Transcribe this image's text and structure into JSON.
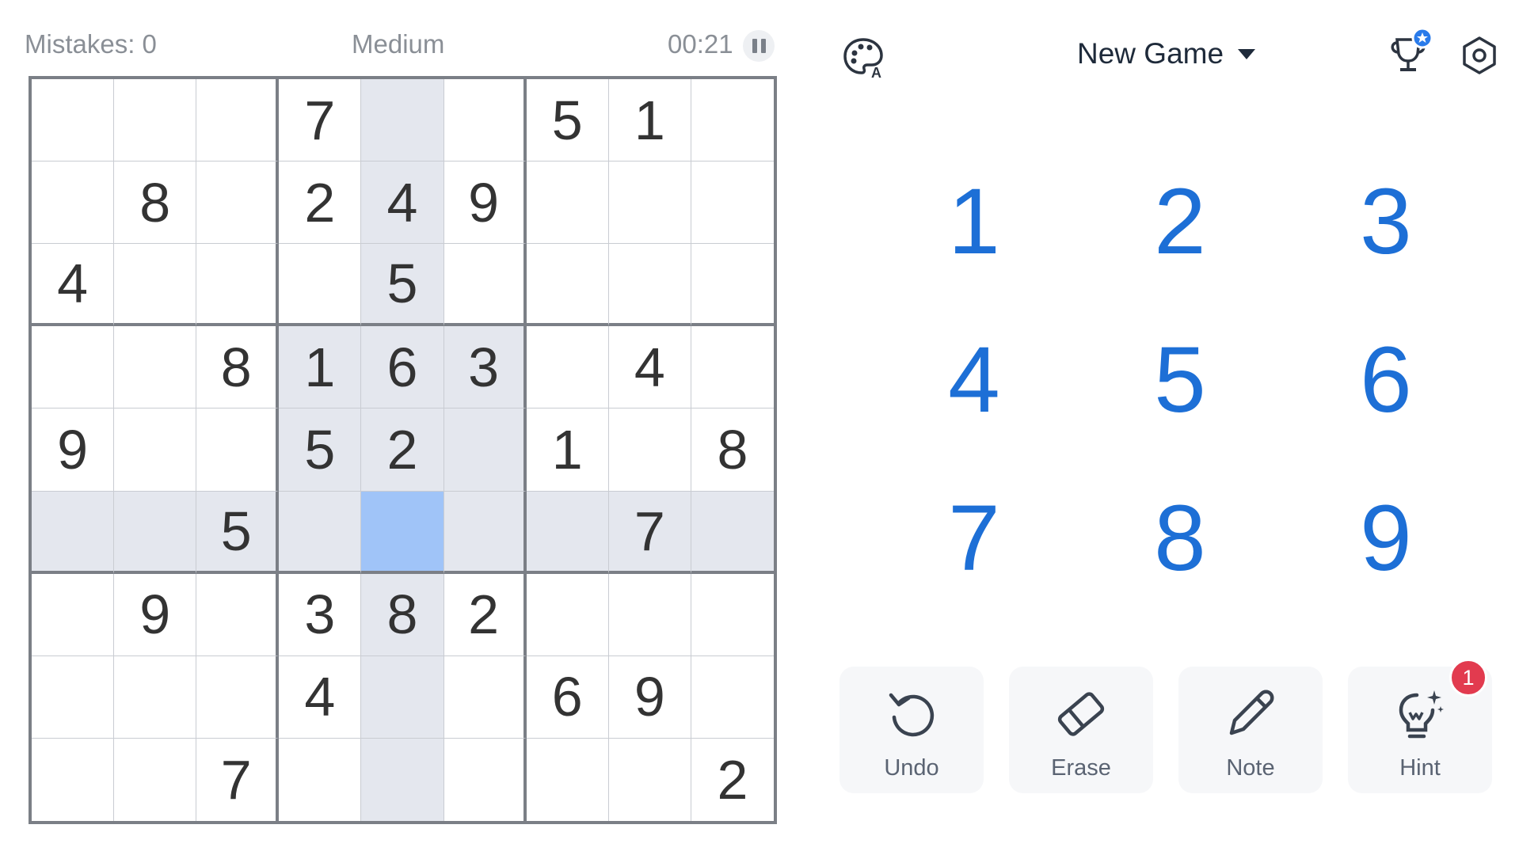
{
  "header": {
    "mistakes": "Mistakes: 0",
    "difficulty": "Medium",
    "timer": "00:21",
    "new_game_label": "New Game"
  },
  "board": {
    "rows": [
      [
        "",
        "",
        "",
        "7",
        "",
        "",
        "5",
        "1",
        ""
      ],
      [
        "",
        "8",
        "",
        "2",
        "4",
        "9",
        "",
        "",
        ""
      ],
      [
        "4",
        "",
        "",
        "",
        "5",
        "",
        "",
        "",
        ""
      ],
      [
        "",
        "",
        "8",
        "1",
        "6",
        "3",
        "",
        "4",
        ""
      ],
      [
        "9",
        "",
        "",
        "5",
        "2",
        "",
        "1",
        "",
        "8"
      ],
      [
        "",
        "",
        "5",
        "",
        "",
        "",
        "",
        "7",
        ""
      ],
      [
        "",
        "9",
        "",
        "3",
        "8",
        "2",
        "",
        "",
        ""
      ],
      [
        "",
        "",
        "",
        "4",
        "",
        "",
        "6",
        "9",
        ""
      ],
      [
        "",
        "",
        "7",
        "",
        "",
        "",
        "",
        "",
        "2"
      ]
    ],
    "selected_cell": {
      "row": 5,
      "col": 4
    }
  },
  "numpad": [
    "1",
    "2",
    "3",
    "4",
    "5",
    "6",
    "7",
    "8",
    "9"
  ],
  "tools": {
    "undo_label": "Undo",
    "erase_label": "Erase",
    "note_label": "Note",
    "hint_label": "Hint",
    "hint_badge": "1"
  },
  "colors": {
    "accent": "#1d6fd6",
    "highlight": "#e4e7ee",
    "selected": "#a0c4f8",
    "badge": "#e23b4f",
    "trophy_star": "#2a7bea"
  },
  "icons": {
    "palette": "palette-icon",
    "trophy": "trophy-icon",
    "settings": "settings-icon",
    "pause": "pause-icon",
    "undo": "undo-icon",
    "erase": "eraser-icon",
    "note": "pencil-icon",
    "hint": "lightbulb-icon"
  }
}
